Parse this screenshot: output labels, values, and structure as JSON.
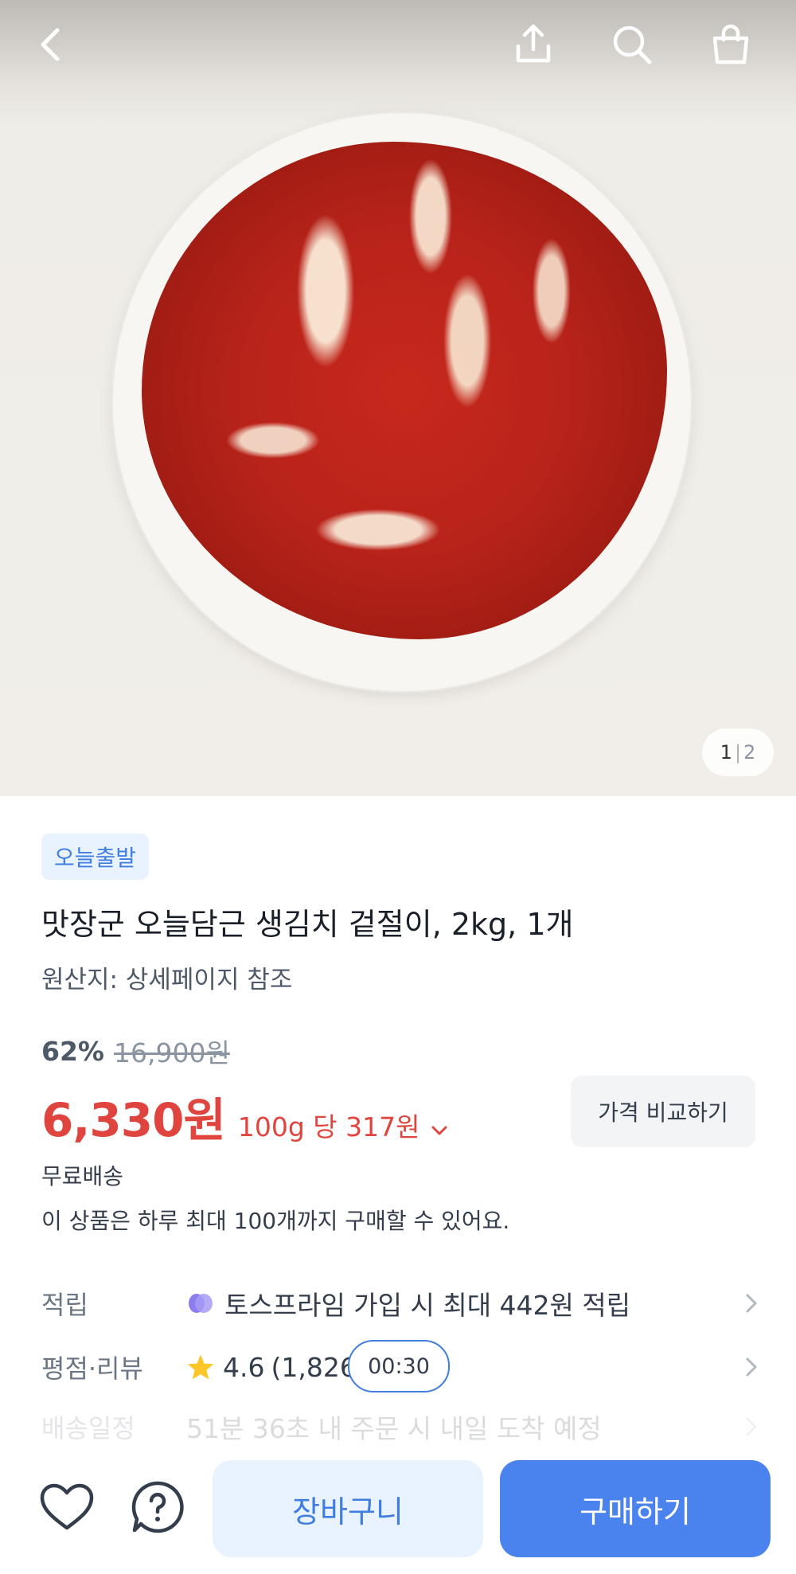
{
  "gallery": {
    "current": "1",
    "separator": "|",
    "total": "2"
  },
  "header": {
    "icons": [
      "back-icon",
      "share-icon",
      "search-icon",
      "shopping-bag-icon"
    ]
  },
  "badge": "오늘출발",
  "product": {
    "title": "맛장군 오늘담근 생김치 겉절이, 2kg, 1개",
    "origin": "원산지: 상세페이지 참조"
  },
  "pricing": {
    "discount_percent": "62%",
    "original_price": "16,900원",
    "price": "6,330원",
    "unit_price": "100g 당 317원",
    "compare_button": "가격 비교하기"
  },
  "shipping": {
    "label": "무료배송",
    "limit_notice": "이 상품은 하루 최대 100개까지 구매할 수 있어요."
  },
  "rows": {
    "points": {
      "label": "적립",
      "text": "토스프라임 가입 시 최대 442원 적립"
    },
    "rating": {
      "label": "평점·리뷰",
      "score": "4.6",
      "count": "(1,826"
    },
    "delivery": {
      "label": "배송일정",
      "text": "51분 36초 내 주문 시 내일 도착 예정"
    }
  },
  "timer": "00:30",
  "bottom": {
    "cart_label": "장바구니",
    "buy_label": "구매하기"
  },
  "colors": {
    "accent_blue": "#4a82ee",
    "price_red": "#e0443e",
    "badge_bg": "#e8f3ff",
    "star": "#ffc629"
  }
}
